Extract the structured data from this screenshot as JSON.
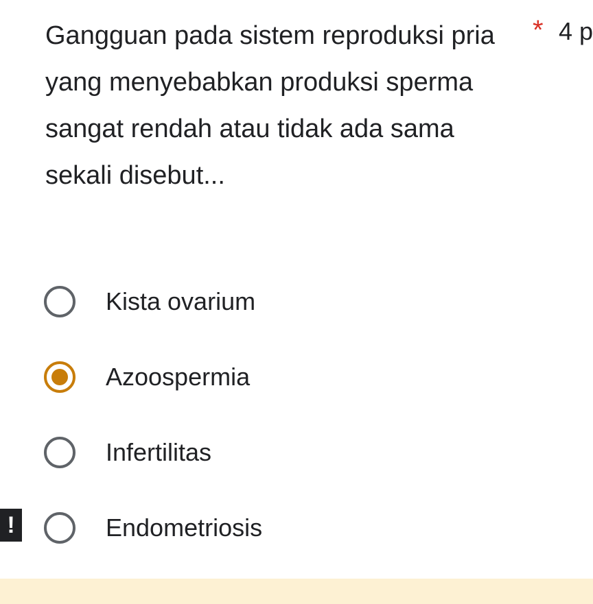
{
  "question": {
    "title": "Gangguan pada sistem reproduksi pria yang menyebabkan produksi sperma sangat rendah atau tidak ada sama sekali disebut...",
    "required_marker": "*",
    "points": "4 p"
  },
  "options": [
    {
      "label": "Kista ovarium",
      "selected": false
    },
    {
      "label": "Azoospermia",
      "selected": true
    },
    {
      "label": "Infertilitas",
      "selected": false
    },
    {
      "label": "Endometriosis",
      "selected": false
    }
  ],
  "error_marker": "!",
  "colors": {
    "selected_accent": "#c87d0a",
    "required_star": "#d93025",
    "feedback_band": "#fdf1d3"
  }
}
